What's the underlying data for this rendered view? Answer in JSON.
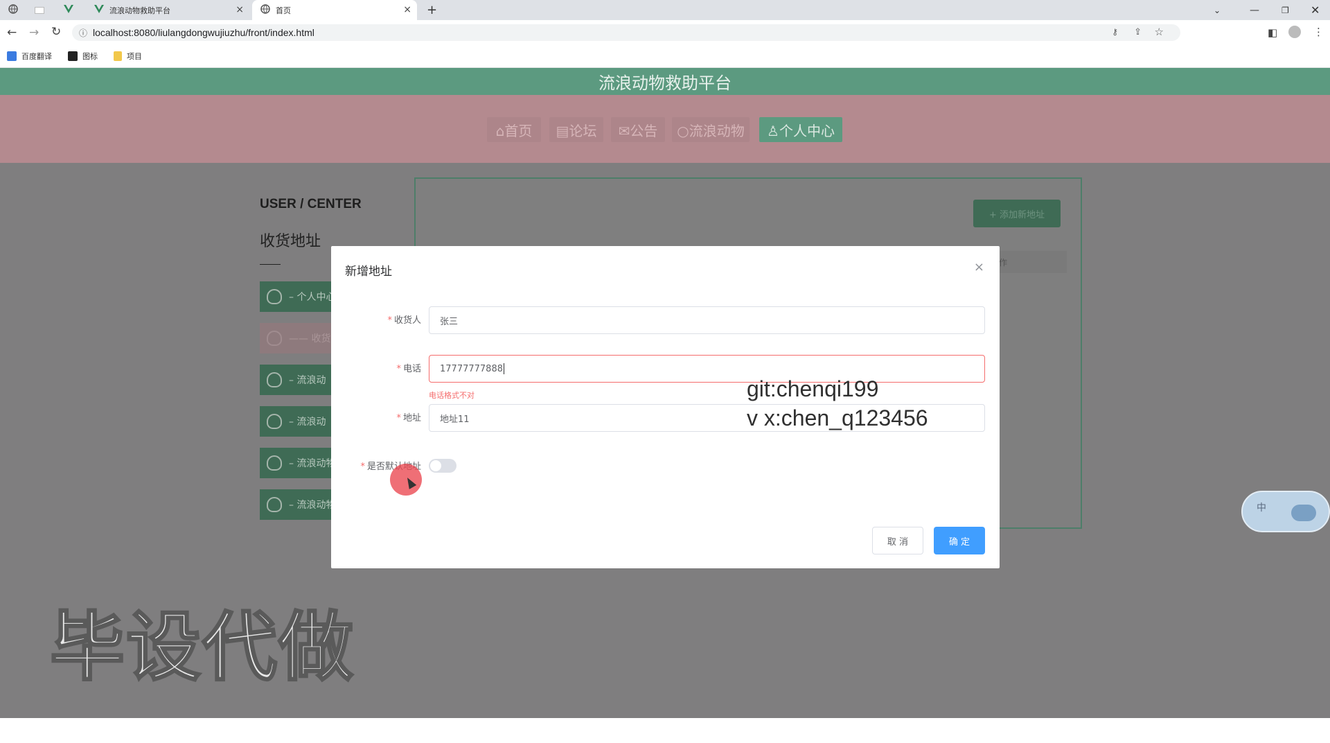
{
  "browser": {
    "tabs": [
      {
        "label": ""
      },
      {
        "label": ""
      },
      {
        "label": "流浪动物救助平台"
      },
      {
        "label": "首页"
      }
    ],
    "new_tab": "+",
    "url": "localhost:8080/liulangdongwujiuzhu/front/index.html",
    "bookmarks": [
      "百度翻译",
      "图标",
      "项目"
    ]
  },
  "site": {
    "title": "流浪动物救助平台",
    "nav": [
      {
        "icon": "home-icon",
        "label": "⌂首页"
      },
      {
        "icon": "forum-icon",
        "label": "▤论坛"
      },
      {
        "icon": "notice-icon",
        "label": "✉公告"
      },
      {
        "icon": "animal-icon",
        "label": "○流浪动物"
      },
      {
        "icon": "user-icon",
        "label": "♙个人中心"
      }
    ]
  },
  "user_center": {
    "heading": "USER / CENTER",
    "subheading": "收货地址",
    "menu": [
      {
        "label": "– 个人中心"
      },
      {
        "label": "—— 收货"
      },
      {
        "label": "– 流浪动"
      },
      {
        "label": "– 流浪动"
      },
      {
        "label": "– 流浪动物"
      },
      {
        "label": "– 流浪动物"
      }
    ],
    "add_address_button": "+ 添加新地址",
    "table_header_fragment": "作"
  },
  "dialog": {
    "title": "新增地址",
    "close": "×",
    "fields": {
      "receiver": {
        "label": "收货人",
        "value": "张三"
      },
      "phone": {
        "label": "电话",
        "value": "17777777888",
        "error": "电话格式不对"
      },
      "address": {
        "label": "地址",
        "value": "地址11"
      },
      "is_default": {
        "label": "是否默认地址",
        "checked": false
      }
    },
    "cancel": "取 消",
    "confirm": "确 定"
  },
  "overlays": {
    "git": "git:chenqi199",
    "wechat": "v x:chen_q123456",
    "watermark": "毕设代做",
    "ime": "中"
  },
  "colors": {
    "primary": "#409eff",
    "error": "#f56c6c",
    "site_green": "#5c9a80",
    "nav_pink": "#b48a8f"
  }
}
